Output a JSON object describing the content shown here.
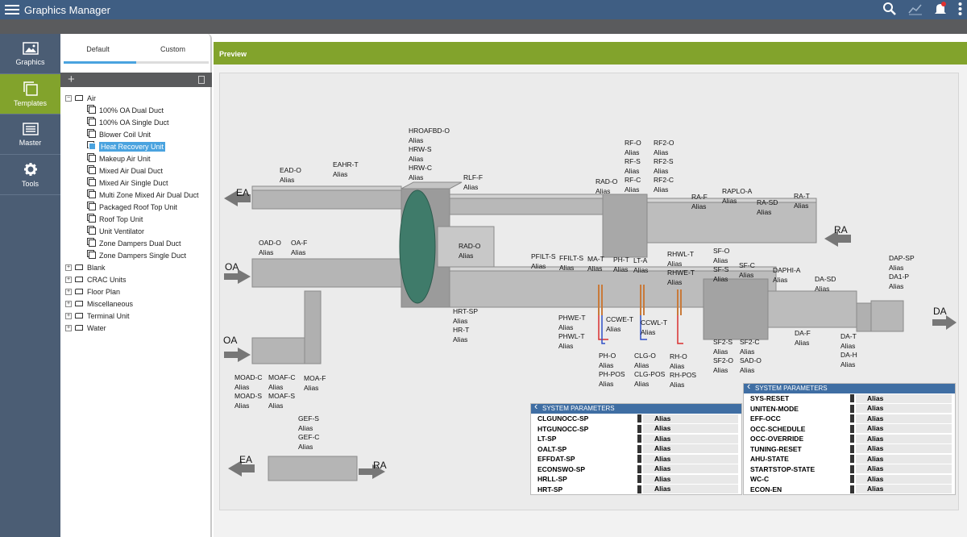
{
  "app": {
    "title": "Graphics Manager"
  },
  "nav": [
    {
      "label": "Graphics",
      "icon": "image-icon",
      "active": false
    },
    {
      "label": "Templates",
      "icon": "templates-icon",
      "active": true
    },
    {
      "label": "Master",
      "icon": "master-icon",
      "active": false
    },
    {
      "label": "Tools",
      "icon": "gear-icon",
      "active": false
    }
  ],
  "tabs": {
    "default": "Default",
    "custom": "Custom"
  },
  "tree": {
    "root": "Air",
    "children": [
      "100% OA Dual Duct",
      "100% OA Single Duct",
      "Blower Coil Unit",
      "Heat Recovery Unit",
      "Makeup Air Unit",
      "Mixed Air Dual Duct",
      "Mixed Air Single Duct",
      "Multi Zone Mixed Air Dual Duct",
      "Packaged Roof Top Unit",
      "Roof Top Unit",
      "Unit Ventilator",
      "Zone Dampers Dual Duct",
      "Zone Dampers Single Duct"
    ],
    "selected": "Heat Recovery Unit",
    "folders": [
      "Blank",
      "CRAC Units",
      "Floor Plan",
      "Miscellaneous",
      "Terminal Unit",
      "Water"
    ]
  },
  "preview": {
    "label": "Preview"
  },
  "diagram": {
    "arrows": {
      "ea_top": "EA",
      "oa_mid": "OA",
      "oa_low": "OA",
      "ra_top": "RA",
      "da": "DA",
      "ea_bot": "EA",
      "ra_bot": "RA"
    },
    "points": [
      {
        "id": "hroafbd",
        "lines": [
          "HROAFBD-O",
          "Alias",
          "HRW-S",
          "Alias",
          "HRW-C",
          "Alias"
        ]
      },
      {
        "id": "ead",
        "lines": [
          "EAD-O",
          "Alias"
        ]
      },
      {
        "id": "eahr",
        "lines": [
          "EAHR-T",
          "Alias"
        ]
      },
      {
        "id": "rlf",
        "lines": [
          "RLF-F",
          "Alias"
        ]
      },
      {
        "id": "rad-o-1",
        "lines": [
          "RAD-O",
          "Alias"
        ]
      },
      {
        "id": "rf",
        "lines": [
          "RF-O",
          "Alias",
          "RF-S",
          "Alias",
          "RF-C",
          "Alias"
        ]
      },
      {
        "id": "rf2",
        "lines": [
          "RF2-O",
          "Alias",
          "RF2-S",
          "Alias",
          "RF2-C",
          "Alias"
        ]
      },
      {
        "id": "ra-f",
        "lines": [
          "RA-F",
          "Alias"
        ]
      },
      {
        "id": "raplo",
        "lines": [
          "RAPLO-A",
          "Alias"
        ]
      },
      {
        "id": "ra-sd",
        "lines": [
          "RA-SD",
          "Alias"
        ]
      },
      {
        "id": "ra-t",
        "lines": [
          "RA-T",
          "Alias"
        ]
      },
      {
        "id": "oad",
        "lines": [
          "OAD-O",
          "Alias"
        ]
      },
      {
        "id": "oa-f",
        "lines": [
          "OA-F",
          "Alias"
        ]
      },
      {
        "id": "rad-o-2",
        "lines": [
          "RAD-O",
          "Alias"
        ]
      },
      {
        "id": "pfilt-s",
        "lines": [
          "PFILT-S",
          "Alias"
        ]
      },
      {
        "id": "ffilt-s",
        "lines": [
          "FFILT-S",
          "Alias"
        ]
      },
      {
        "id": "ma-t",
        "lines": [
          "MA-T",
          "Alias"
        ]
      },
      {
        "id": "ph-t",
        "lines": [
          "PH-T",
          "Alias"
        ]
      },
      {
        "id": "lt-a",
        "lines": [
          "LT-A",
          "Alias"
        ]
      },
      {
        "id": "rhwl",
        "lines": [
          "RHWL-T",
          "Alias",
          "RHWE-T",
          "Alias"
        ]
      },
      {
        "id": "sf",
        "lines": [
          "SF-O",
          "Alias",
          "SF-S",
          "Alias"
        ]
      },
      {
        "id": "sf-c",
        "lines": [
          "SF-C",
          "Alias"
        ]
      },
      {
        "id": "daphi",
        "lines": [
          "DAPHI-A",
          "Alias"
        ]
      },
      {
        "id": "da-sd",
        "lines": [
          "DA-SD",
          "Alias"
        ]
      },
      {
        "id": "dap",
        "lines": [
          "DAP-SP",
          "Alias",
          "DA1-P",
          "Alias"
        ]
      },
      {
        "id": "hrt-sp",
        "lines": [
          "HRT-SP",
          "Alias",
          "HR-T",
          "Alias"
        ]
      },
      {
        "id": "phwe",
        "lines": [
          "PHWE-T",
          "Alias",
          "PHWL-T",
          "Alias"
        ]
      },
      {
        "id": "ccwe",
        "lines": [
          "CCWE-T",
          "Alias"
        ]
      },
      {
        "id": "ccwl",
        "lines": [
          "CCWL-T",
          "Alias"
        ]
      },
      {
        "id": "ph-o",
        "lines": [
          "PH-O",
          "Alias",
          "PH-POS",
          "Alias"
        ]
      },
      {
        "id": "clg-o",
        "lines": [
          "CLG-O",
          "Alias",
          "CLG-POS",
          "Alias"
        ]
      },
      {
        "id": "rh-o",
        "lines": [
          "RH-O",
          "Alias",
          "RH-POS",
          "Alias"
        ]
      },
      {
        "id": "sf2-s",
        "lines": [
          "SF2-S",
          "Alias",
          "SF2-O",
          "Alias"
        ]
      },
      {
        "id": "sf2-c",
        "lines": [
          "SF2-C",
          "Alias",
          "SAD-O",
          "Alias"
        ]
      },
      {
        "id": "da-f",
        "lines": [
          "DA-F",
          "Alias"
        ]
      },
      {
        "id": "da-t",
        "lines": [
          "DA-T",
          "Alias",
          "DA-H",
          "Alias"
        ]
      },
      {
        "id": "moad",
        "lines": [
          "MOAD-C",
          "Alias",
          "MOAD-S",
          "Alias"
        ]
      },
      {
        "id": "moaf",
        "lines": [
          "MOAF-C",
          "Alias",
          "MOAF-S",
          "Alias"
        ]
      },
      {
        "id": "moa-f",
        "lines": [
          "MOA-F",
          "Alias"
        ]
      },
      {
        "id": "gef",
        "lines": [
          "GEF-S",
          "Alias",
          "GEF-C",
          "Alias"
        ]
      }
    ]
  },
  "sys_params_1": {
    "title": "SYSTEM PARAMETERS",
    "rows": [
      {
        "k": "CLGUNOCC-SP",
        "v": "Alias"
      },
      {
        "k": "HTGUNOCC-SP",
        "v": "Alias"
      },
      {
        "k": "LT-SP",
        "v": "Alias"
      },
      {
        "k": "OALT-SP",
        "v": "Alias"
      },
      {
        "k": "EFFDAT-SP",
        "v": "Alias"
      },
      {
        "k": "ECONSWO-SP",
        "v": "Alias"
      },
      {
        "k": "HRLL-SP",
        "v": "Alias"
      },
      {
        "k": "HRT-SP",
        "v": "Alias"
      }
    ]
  },
  "sys_params_2": {
    "title": "SYSTEM PARAMETERS",
    "rows": [
      {
        "k": "SYS-RESET",
        "v": "Alias"
      },
      {
        "k": "UNITEN-MODE",
        "v": "Alias"
      },
      {
        "k": "EFF-OCC",
        "v": "Alias"
      },
      {
        "k": "OCC-SCHEDULE",
        "v": "Alias"
      },
      {
        "k": "OCC-OVERRIDE",
        "v": "Alias"
      },
      {
        "k": "TUNING-RESET",
        "v": "Alias"
      },
      {
        "k": "AHU-STATE",
        "v": "Alias"
      },
      {
        "k": "STARTSTOP-STATE",
        "v": "Alias"
      },
      {
        "k": "WC-C",
        "v": "Alias"
      },
      {
        "k": "ECON-EN",
        "v": "Alias"
      }
    ]
  },
  "colors": {
    "topbar": "#3f5e83",
    "accent": "#82a32c",
    "nav": "#4b5d74",
    "selection": "#4aa3df",
    "panel_header": "#3f6ea3"
  }
}
